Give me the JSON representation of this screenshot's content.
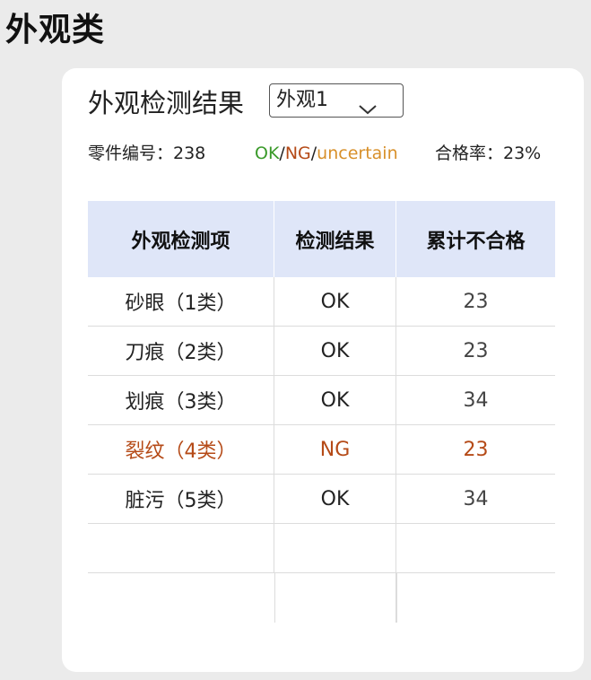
{
  "page": {
    "title": "外观类"
  },
  "card": {
    "title": "外观检测结果",
    "select": {
      "value": "外观1"
    },
    "meta": {
      "part_label": "零件编号：238",
      "legend": {
        "ok": "OK",
        "ng": "NG",
        "uncertain": "uncertain",
        "separator": "/"
      },
      "pass_rate": "合格率：23%"
    },
    "colors": {
      "ok": "#3a9a2a",
      "ng": "#b54a17",
      "uncertain": "#d8902a",
      "header_bg": "#dfe6f8"
    },
    "table": {
      "headers": [
        "外观检测项",
        "检测结果",
        "累计不合格"
      ],
      "rows": [
        {
          "item": "砂眼（1类）",
          "result": "OK",
          "count": "23",
          "status": "ok"
        },
        {
          "item": "刀痕（2类）",
          "result": "OK",
          "count": "23",
          "status": "ok"
        },
        {
          "item": "划痕（3类）",
          "result": "OK",
          "count": "34",
          "status": "ok"
        },
        {
          "item": "裂纹（4类）",
          "result": "NG",
          "count": "23",
          "status": "ng"
        },
        {
          "item": "脏污（5类）",
          "result": "OK",
          "count": "34",
          "status": "ok"
        }
      ],
      "empty_rows": 2
    }
  },
  "icons": {
    "dropdown": "chevron-down-icon"
  }
}
